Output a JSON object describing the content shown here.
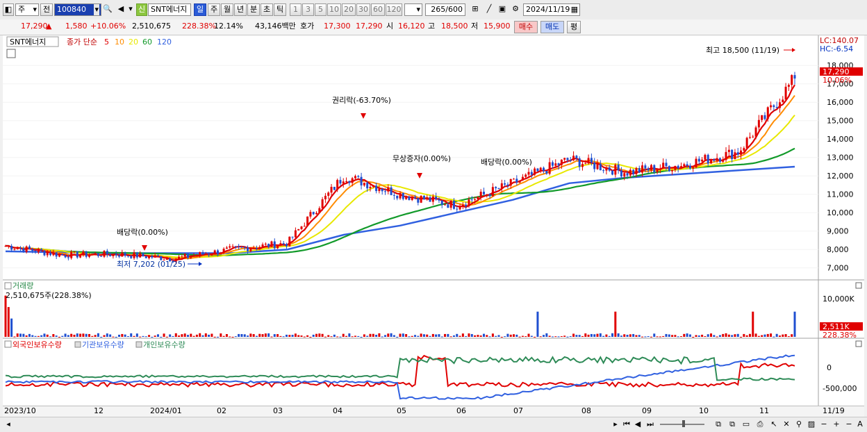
{
  "toolbar": {
    "market": "주",
    "prev": "전",
    "code": "100840",
    "new_badge": "신",
    "stock_name": "SNT에너지",
    "periods": [
      "일",
      "주",
      "월",
      "년",
      "분",
      "초",
      "틱"
    ],
    "numbers": [
      "1",
      "3",
      "5",
      "10",
      "20",
      "30",
      "60",
      "120"
    ],
    "count": "265",
    "count_total": "/600",
    "date": "2024/11/19"
  },
  "quote": {
    "price": "17,290",
    "change": "1,580",
    "change_pct": "+10.06%",
    "volume": "2,510,675",
    "vol_pct": "228.38%",
    "turnover": "12.14%",
    "amount": "43,146백만",
    "hoga_label": "호가",
    "hoga_ask": "17,300",
    "hoga_bid": "17,290",
    "open_label": "시",
    "open": "16,120",
    "high_label": "고",
    "high": "18,500",
    "low_label": "저",
    "low": "15,900",
    "buy": "매수",
    "sell": "매도",
    "avg": "평"
  },
  "price_panel": {
    "legend_name": "SNT에너지",
    "legend_ma_title": "종가 단순",
    "ma": [
      {
        "period": "5",
        "color": "#e00000"
      },
      {
        "period": "10",
        "color": "#ff8c00"
      },
      {
        "period": "20",
        "color": "#e8e800"
      },
      {
        "period": "60",
        "color": "#129a2a"
      },
      {
        "period": "120",
        "color": "#3060e0"
      }
    ],
    "lc": "LC:140.07",
    "hc": "HC:-6.54",
    "y_ticks": [
      "18,000",
      "17,000",
      "16,000",
      "15,000",
      "14,000",
      "13,000",
      "12,000",
      "11,000",
      "10,000",
      "9,000",
      "8,000",
      "7,000"
    ],
    "current_price_tag": "17,290",
    "current_pct": "10.06%",
    "annotations": {
      "high": "최고 18,500 (11/19)",
      "low": "최저 7,202 (01/25)",
      "div1": "배당락(0.00%)",
      "rights": "권리락(-63.70%)",
      "bonus": "무상증자(0.00%)",
      "div2": "배당락(0.00%)"
    }
  },
  "volume_panel": {
    "title": "거래량",
    "value": "2,510,675주(228.38%)",
    "y_tick": "10,000K",
    "current_tag": "2,511K",
    "current_pct": "228.38%"
  },
  "holder_panel": {
    "series": [
      "외국인보유수량",
      "기관보유수량",
      "개인보유수량"
    ],
    "series_colors": [
      "#e00000",
      "#3060e0",
      "#2e8b57"
    ],
    "y_ticks": [
      "0",
      "-500,000"
    ]
  },
  "x_axis": [
    "2023/10",
    "12",
    "2024/01",
    "02",
    "03",
    "04",
    "05",
    "06",
    "07",
    "08",
    "09",
    "10",
    "11",
    "11/19"
  ],
  "chart_data": {
    "type": "line",
    "title": "",
    "x": [
      "2023/10",
      "12",
      "2024/01",
      "02",
      "03",
      "04",
      "05",
      "06",
      "07",
      "08",
      "09",
      "10",
      "11",
      "11/19"
    ],
    "ylim": [
      6500,
      18800
    ],
    "series": [
      {
        "name": "종가",
        "values": [
          8200,
          7700,
          7750,
          7500,
          8000,
          8350,
          12000,
          11000,
          10400,
          11600,
          12900,
          12200,
          12600,
          13300,
          17290
        ]
      },
      {
        "name": "120",
        "values": [
          7900,
          7850,
          7800,
          7800,
          7800,
          8000,
          8800,
          9300,
          10000,
          10700,
          11600,
          11900,
          12100,
          12300,
          12500
        ]
      }
    ]
  }
}
